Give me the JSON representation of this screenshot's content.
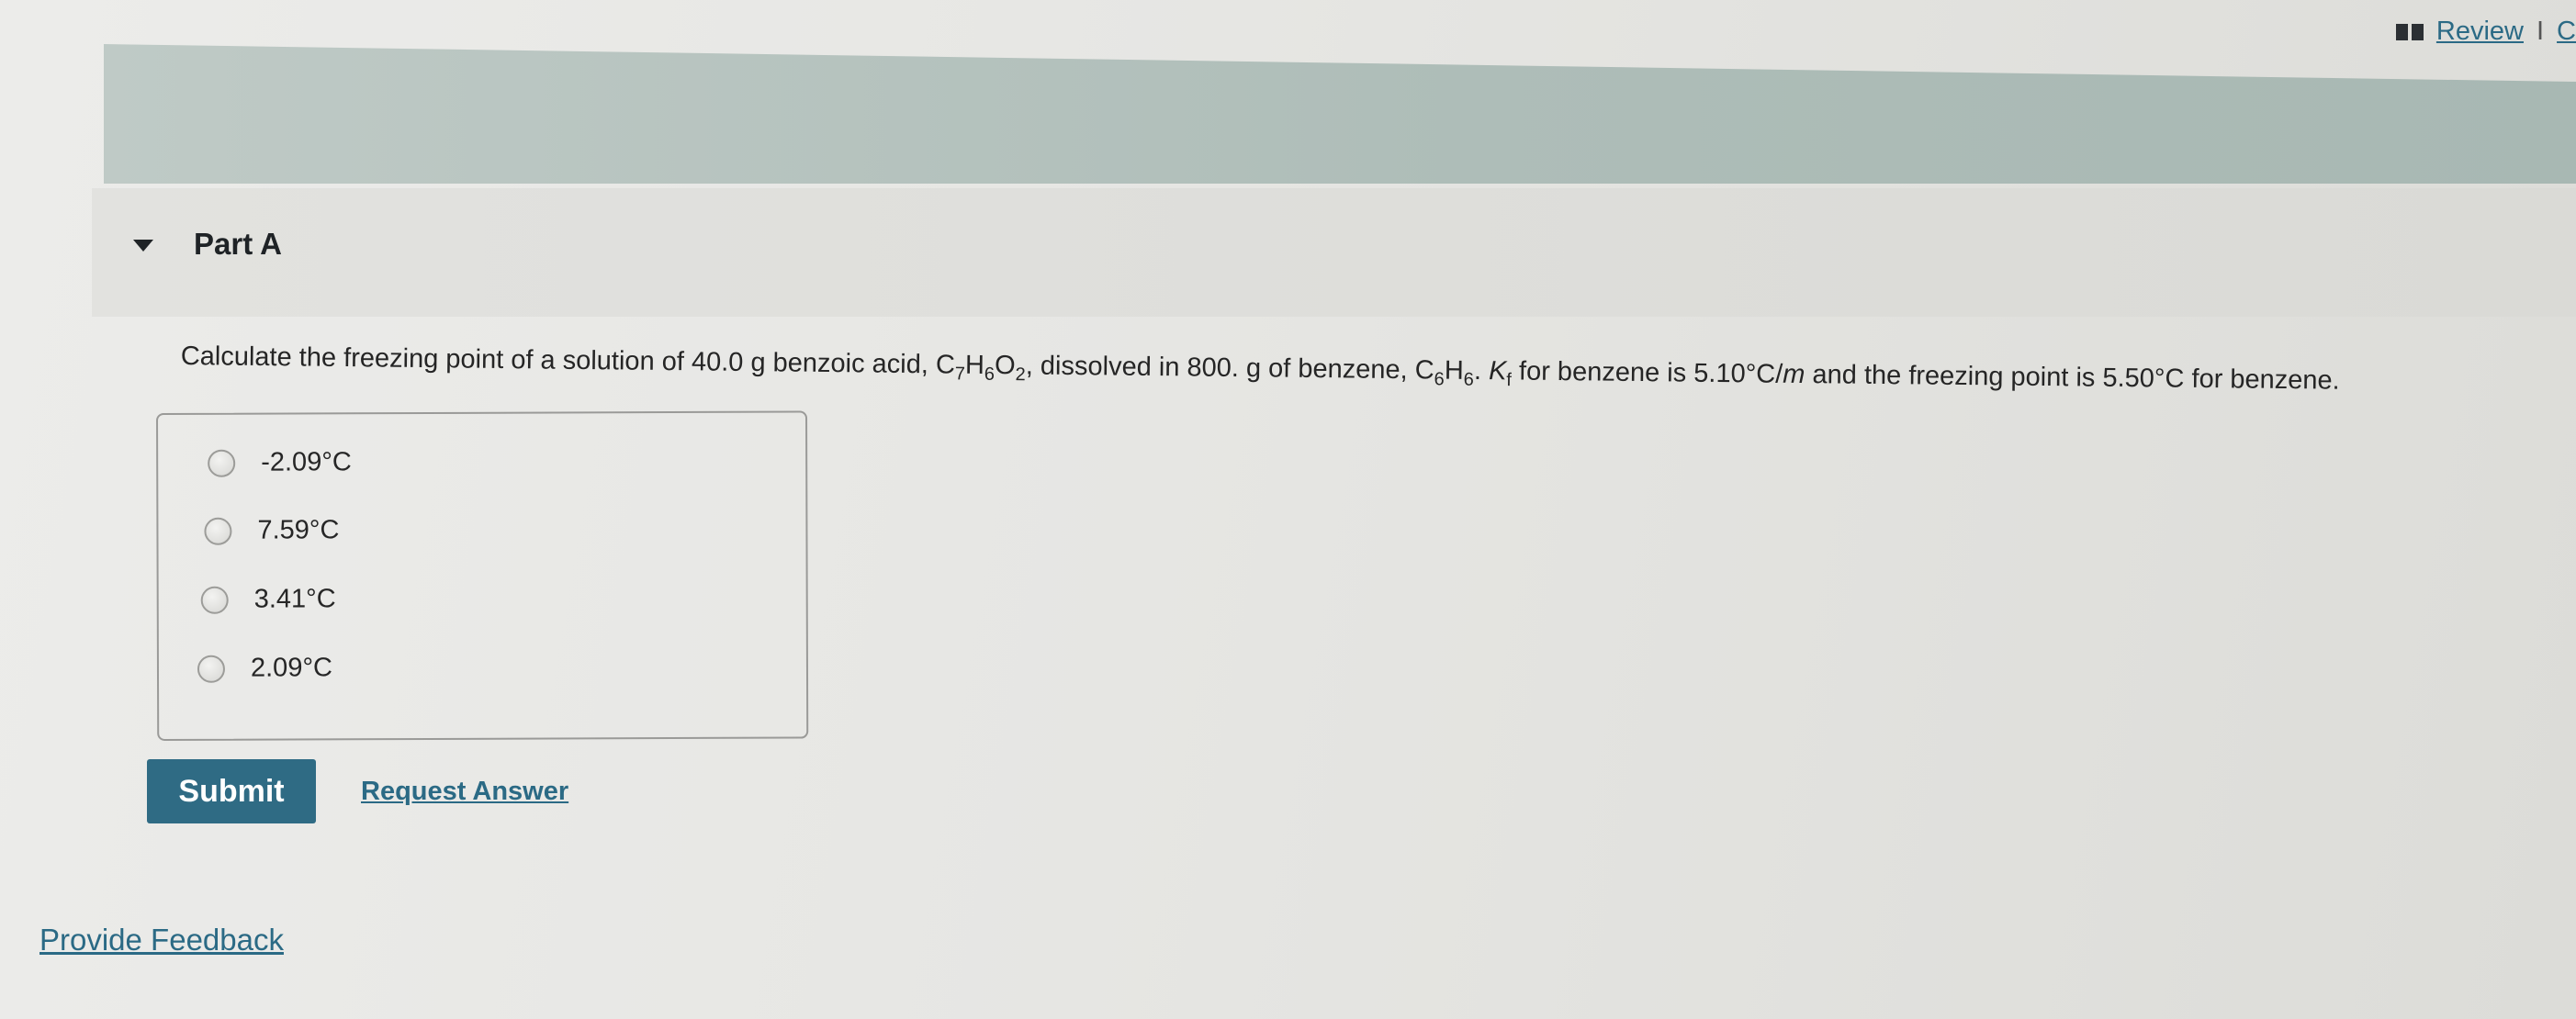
{
  "header": {
    "review_label": "Review",
    "separator": "I",
    "cut_link_label": "C"
  },
  "part": {
    "title": "Part A"
  },
  "question": {
    "segments": {
      "s1": "Calculate the freezing point of a solution of 40.0 g benzoic acid, C",
      "sub1": "7",
      "s2": "H",
      "sub2": "6",
      "s3": "O",
      "sub3": "2",
      "s4": ", dissolved in 800. g of benzene, C",
      "sub4": "6",
      "s5": "H",
      "sub5": "6",
      "s6": ". ",
      "k": "K",
      "ksub": "f",
      "s7": " for benzene is 5.10°C/",
      "m": "m",
      "s8": " and the freezing point is 5.50°C for benzene."
    }
  },
  "options": [
    {
      "label": "-2.09°C"
    },
    {
      "label": "7.59°C"
    },
    {
      "label": "3.41°C"
    },
    {
      "label": "2.09°C"
    }
  ],
  "actions": {
    "submit_label": "Submit",
    "request_answer_label": "Request Answer"
  },
  "footer": {
    "feedback_label": "Provide Feedback"
  }
}
